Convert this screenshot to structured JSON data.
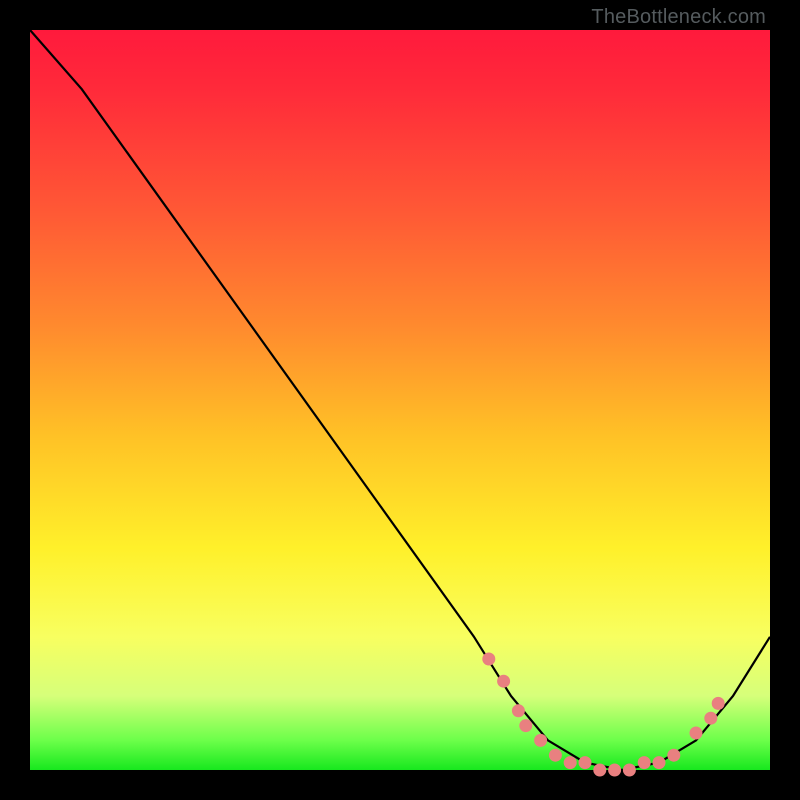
{
  "watermark": "TheBottleneck.com",
  "colors": {
    "curve_stroke": "#000000",
    "marker_fill": "#e98080",
    "marker_stroke": "#e98080"
  },
  "chart_data": {
    "type": "line",
    "title": "",
    "xlabel": "",
    "ylabel": "",
    "xlim": [
      0,
      100
    ],
    "ylim": [
      0,
      100
    ],
    "curve_points": [
      {
        "x": 0,
        "y": 100
      },
      {
        "x": 7,
        "y": 92
      },
      {
        "x": 60,
        "y": 18
      },
      {
        "x": 65,
        "y": 10
      },
      {
        "x": 70,
        "y": 4
      },
      {
        "x": 75,
        "y": 1
      },
      {
        "x": 80,
        "y": 0
      },
      {
        "x": 85,
        "y": 1
      },
      {
        "x": 90,
        "y": 4
      },
      {
        "x": 95,
        "y": 10
      },
      {
        "x": 100,
        "y": 18
      }
    ],
    "markers": [
      {
        "x": 62,
        "y": 15
      },
      {
        "x": 64,
        "y": 12
      },
      {
        "x": 66,
        "y": 8
      },
      {
        "x": 67,
        "y": 6
      },
      {
        "x": 69,
        "y": 4
      },
      {
        "x": 71,
        "y": 2
      },
      {
        "x": 73,
        "y": 1
      },
      {
        "x": 75,
        "y": 1
      },
      {
        "x": 77,
        "y": 0
      },
      {
        "x": 79,
        "y": 0
      },
      {
        "x": 81,
        "y": 0
      },
      {
        "x": 83,
        "y": 1
      },
      {
        "x": 85,
        "y": 1
      },
      {
        "x": 87,
        "y": 2
      },
      {
        "x": 90,
        "y": 5
      },
      {
        "x": 92,
        "y": 7
      },
      {
        "x": 93,
        "y": 9
      }
    ]
  }
}
